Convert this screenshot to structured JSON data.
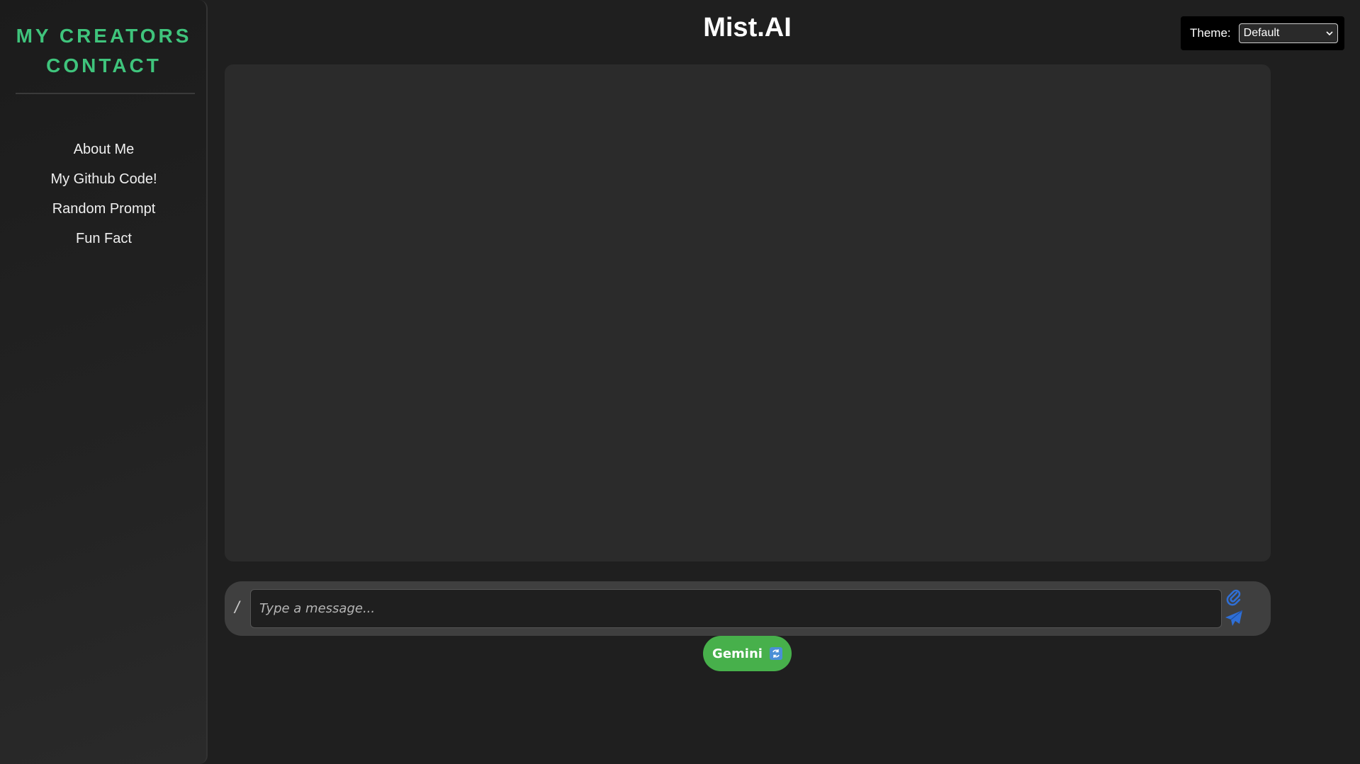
{
  "sidebar": {
    "title_line1": "MY CREATORS",
    "title_line2": "CONTACT",
    "items": [
      {
        "label": "About Me"
      },
      {
        "label": "My Github Code!"
      },
      {
        "label": "Random Prompt"
      },
      {
        "label": "Fun Fact"
      }
    ]
  },
  "header": {
    "title": "Mist.AI"
  },
  "theme": {
    "label": "Theme:",
    "selected": "Default"
  },
  "composer": {
    "prefix": "/",
    "placeholder": "Type a message...",
    "attach_icon": "paperclip-icon",
    "send_icon": "paper-plane-icon"
  },
  "model_toggle": {
    "label": "Gemini",
    "icon": "swap-icon"
  },
  "colors": {
    "accent_green": "#3fc47c",
    "button_green": "#47b04b",
    "icon_blue": "#2f6fd6"
  }
}
